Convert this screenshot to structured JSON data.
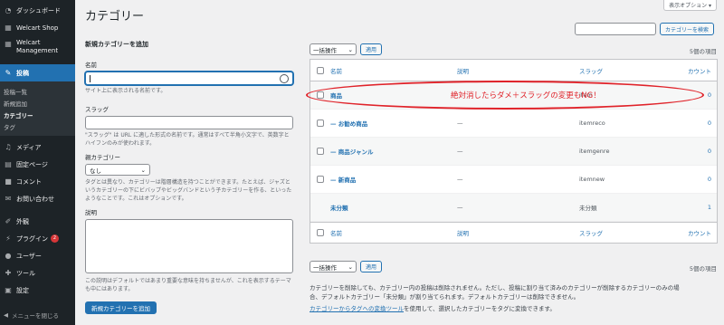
{
  "sidebar": {
    "dashboard": "ダッシュボード",
    "welcart_shop": "Welcart Shop",
    "welcart_management": "Welcart Management",
    "posts": "投稿",
    "sub_items": [
      "投稿一覧",
      "新規追加",
      "カテゴリー",
      "タグ"
    ],
    "media": "メディア",
    "pages": "固定ページ",
    "comments": "コメント",
    "contact": "お問い合わせ",
    "appearance": "外観",
    "plugins": "プラグイン",
    "plugins_badge": "2",
    "users": "ユーザー",
    "tools": "ツール",
    "settings": "設定",
    "collapse": "メニューを閉じる"
  },
  "header": {
    "title": "カテゴリー",
    "screen_options": "表示オプション ▾"
  },
  "form": {
    "heading": "新規カテゴリーを追加",
    "name_label": "名前",
    "name_desc": "サイト上に表示される名前です。",
    "slug_label": "スラッグ",
    "slug_desc_1": "\"スラッグ\" は URL に適した形式の名前です。通常はすべて半角小文字で、英数字とハイフンのみが使われます。",
    "parent_label": "親カテゴリー",
    "parent_value": "なし",
    "parent_desc": "タグとは異なり、カテゴリーは階層構造を持つことができます。たとえば、ジャズというカテゴリーの下にビバップやビッグバンドという子カテゴリーを作る、といったようなことです。これはオプションです。",
    "desc_label": "説明",
    "desc_desc": "この説明はデフォルトではあまり重要な意味を持ちませんが、これを表示するテーマも中にはあります。",
    "submit": "新規カテゴリーを追加"
  },
  "table": {
    "search_button": "カテゴリーを検索",
    "bulk_label": "一括操作",
    "apply": "適用",
    "item_count": "5個の項目",
    "columns": {
      "name": "名前",
      "desc": "説明",
      "slug": "スラッグ",
      "count": "カウント"
    },
    "rows": [
      {
        "name": "商品",
        "desc": "",
        "slug": "item",
        "count": "0"
      },
      {
        "name": "— お勧め商品",
        "desc": "—",
        "slug": "itemreco",
        "count": "0"
      },
      {
        "name": "— 商品ジャンル",
        "desc": "—",
        "slug": "itemgenre",
        "count": "0"
      },
      {
        "name": "— 新商品",
        "desc": "—",
        "slug": "itemnew",
        "count": "0"
      },
      {
        "name": "未分類",
        "desc": "—",
        "slug": "未分類",
        "count": "1"
      }
    ]
  },
  "annotation": {
    "text": "絶対消したらダメ＋スラッグの変更もNG！",
    "color": "#e0232a"
  },
  "notes": {
    "line1": "カテゴリーを削除しても、カテゴリー内の投稿は削除されません。ただし、投稿に割り当て済みのカテゴリーが削除するカテゴリーのみの場",
    "line2": "合、デフォルトカテゴリー「未分類」が割り当てられます。デフォルトカテゴリーは削除できません。",
    "link": "カテゴリーからタグへの変換ツール",
    "line3": "を使用して、選択したカテゴリーをタグに変換できます。"
  }
}
